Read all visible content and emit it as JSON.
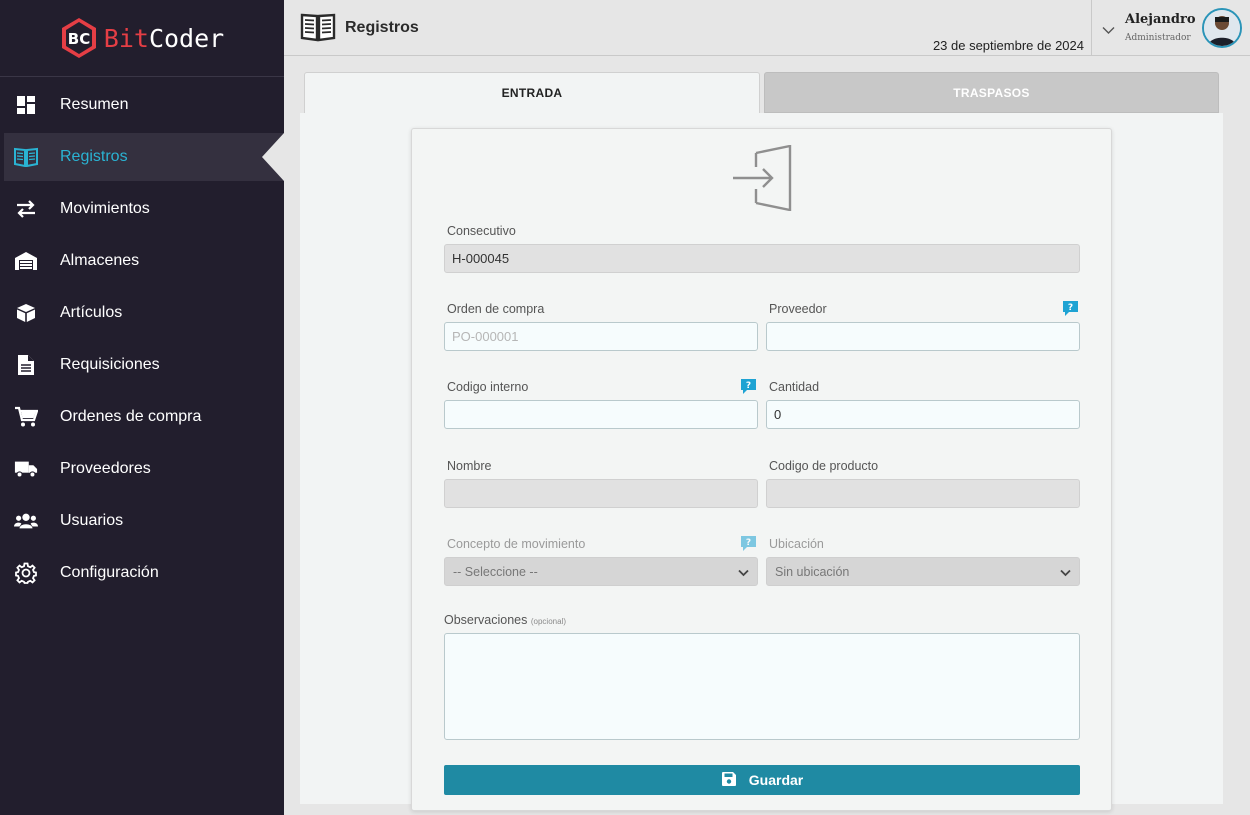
{
  "brand": {
    "bit": "Bit",
    "coder": "Coder",
    "mark": "BC"
  },
  "sidebar": {
    "items": [
      {
        "label": "Resumen",
        "icon": "dashboard-icon"
      },
      {
        "label": "Registros",
        "icon": "book-icon",
        "active": true
      },
      {
        "label": "Movimientos",
        "icon": "transfer-arrows-icon"
      },
      {
        "label": "Almacenes",
        "icon": "warehouse-icon"
      },
      {
        "label": "Artículos",
        "icon": "box-icon"
      },
      {
        "label": "Requisiciones",
        "icon": "document-icon"
      },
      {
        "label": "Ordenes de compra",
        "icon": "cart-icon"
      },
      {
        "label": "Proveedores",
        "icon": "truck-icon"
      },
      {
        "label": "Usuarios",
        "icon": "users-icon"
      },
      {
        "label": "Configuración",
        "icon": "gear-icon"
      }
    ]
  },
  "header": {
    "title": "Registros",
    "date": "23 de septiembre de 2024",
    "user": {
      "name": "Alejandro",
      "role": "Administrador"
    }
  },
  "tabs": [
    {
      "label": "ENTRADA",
      "active": true
    },
    {
      "label": "TRASPASOS",
      "active": false
    }
  ],
  "form": {
    "consecutivo": {
      "label": "Consecutivo",
      "value": "H-000045"
    },
    "orden_compra": {
      "label": "Orden de compra",
      "placeholder": "PO-000001",
      "value": ""
    },
    "proveedor": {
      "label": "Proveedor",
      "value": ""
    },
    "codigo_interno": {
      "label": "Codigo interno",
      "value": ""
    },
    "cantidad": {
      "label": "Cantidad",
      "value": "0"
    },
    "nombre": {
      "label": "Nombre",
      "value": ""
    },
    "codigo_producto": {
      "label": "Codigo de producto",
      "value": ""
    },
    "concepto": {
      "label": "Concepto de movimiento",
      "selected": "-- Seleccione --"
    },
    "ubicacion": {
      "label": "Ubicación",
      "selected": "Sin ubicación"
    },
    "observaciones": {
      "label": "Observaciones",
      "optional": "(opcional)",
      "value": ""
    },
    "save_label": "Guardar"
  },
  "colors": {
    "sidebar_bg": "#221e2d",
    "accent": "#2ab3d3",
    "button": "#1f8aa3",
    "brand_red": "#e53e45",
    "help_badge": "#1ea3d3"
  }
}
